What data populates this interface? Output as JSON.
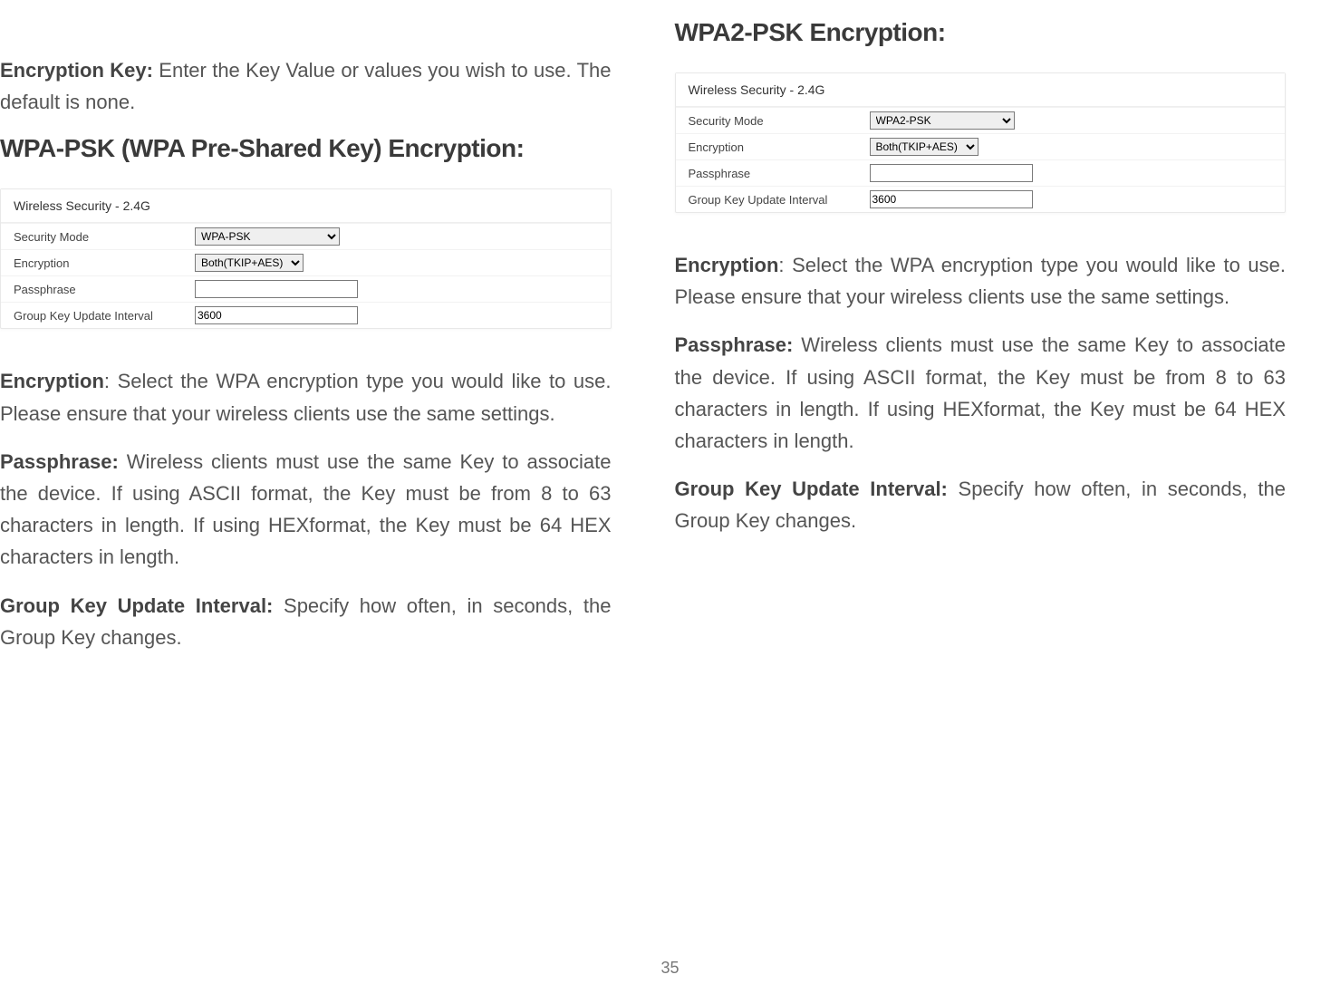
{
  "page_number": "35",
  "left": {
    "intro": {
      "encryption_key_bold": "Encryption Key:",
      "encryption_key_text": " Enter the Key Value or values you wish to use. The default is none."
    },
    "heading": "WPA-PSK (WPA Pre-Shared Key) Encryption:",
    "panel": {
      "title": "Wireless Security - 2.4G",
      "rows": {
        "security_mode": {
          "label": "Security Mode",
          "value": "WPA-PSK"
        },
        "encryption": {
          "label": "Encryption",
          "value": "Both(TKIP+AES)"
        },
        "passphrase": {
          "label": "Passphrase",
          "value": ""
        },
        "group_key": {
          "label": "Group Key Update Interval",
          "value": "3600"
        }
      }
    },
    "body": {
      "encryption_bold": "Encryption",
      "encryption_text": ": Select the WPA encryption type you would like to use. Please ensure that your wireless clients use the same settings.",
      "passphrase_bold": "Passphrase:",
      "passphrase_text": " Wireless clients must use the same Key to associate the device. If using ASCII format, the Key must be from 8 to 63 characters in length. If using HEXformat, the Key must be 64 HEX characters in length.",
      "group_bold": "Group Key Update Interval:",
      "group_text": " Specify how often, in seconds, the Group Key changes."
    }
  },
  "right": {
    "heading": "WPA2-PSK Encryption:",
    "panel": {
      "title": "Wireless Security - 2.4G",
      "rows": {
        "security_mode": {
          "label": "Security Mode",
          "value": "WPA2-PSK"
        },
        "encryption": {
          "label": "Encryption",
          "value": "Both(TKIP+AES)"
        },
        "passphrase": {
          "label": "Passphrase",
          "value": ""
        },
        "group_key": {
          "label": "Group Key Update Interval",
          "value": "3600"
        }
      }
    },
    "body": {
      "encryption_bold": "Encryption",
      "encryption_text": ": Select the WPA encryption type you would like to use. Please ensure that your wireless clients use the same settings.",
      "passphrase_bold": "Passphrase:",
      "passphrase_text": " Wireless clients must use the same Key to associate the device. If using ASCII format, the Key must be from 8 to 63 characters in length. If using HEXformat, the Key must be 64 HEX characters in length.",
      "group_bold": "Group Key Update Interval:",
      "group_text": " Specify how often, in seconds, the Group Key changes."
    }
  }
}
